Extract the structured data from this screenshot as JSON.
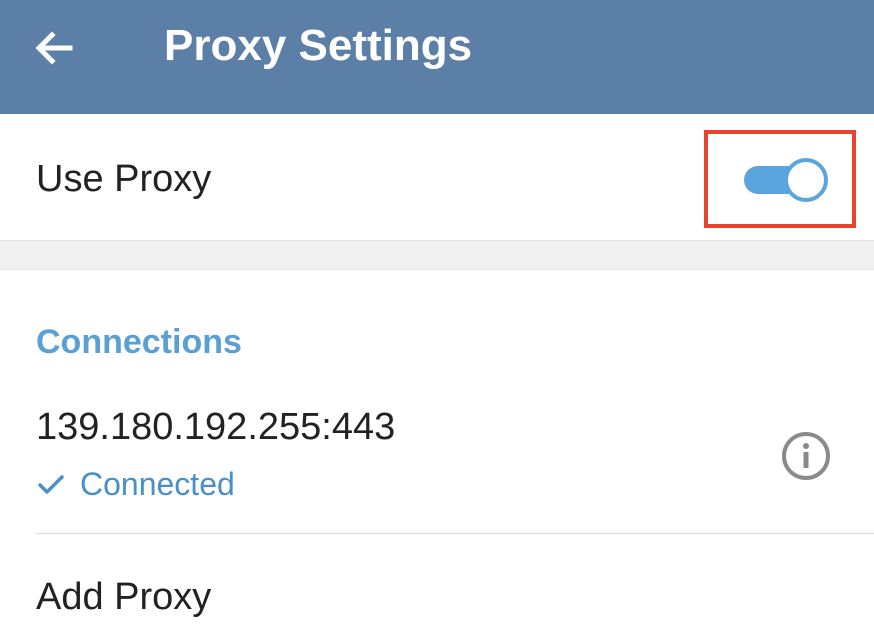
{
  "app_bar": {
    "title": "Proxy Settings",
    "back_icon": "arrow-left-icon",
    "background_color": "#5b7fa6"
  },
  "use_proxy": {
    "label": "Use Proxy",
    "enabled": true,
    "toggle_color": "#5aa5dd",
    "highlight_color": "#e8442f"
  },
  "connections": {
    "header": "Connections",
    "items": [
      {
        "address": "139.180.192.255:443",
        "status": "Connected",
        "status_icon": "check-icon",
        "action_icon": "info-icon"
      }
    ]
  },
  "add_proxy": {
    "label": "Add Proxy"
  },
  "colors": {
    "accent": "#5aa0d2",
    "status": "#4a90c8"
  }
}
